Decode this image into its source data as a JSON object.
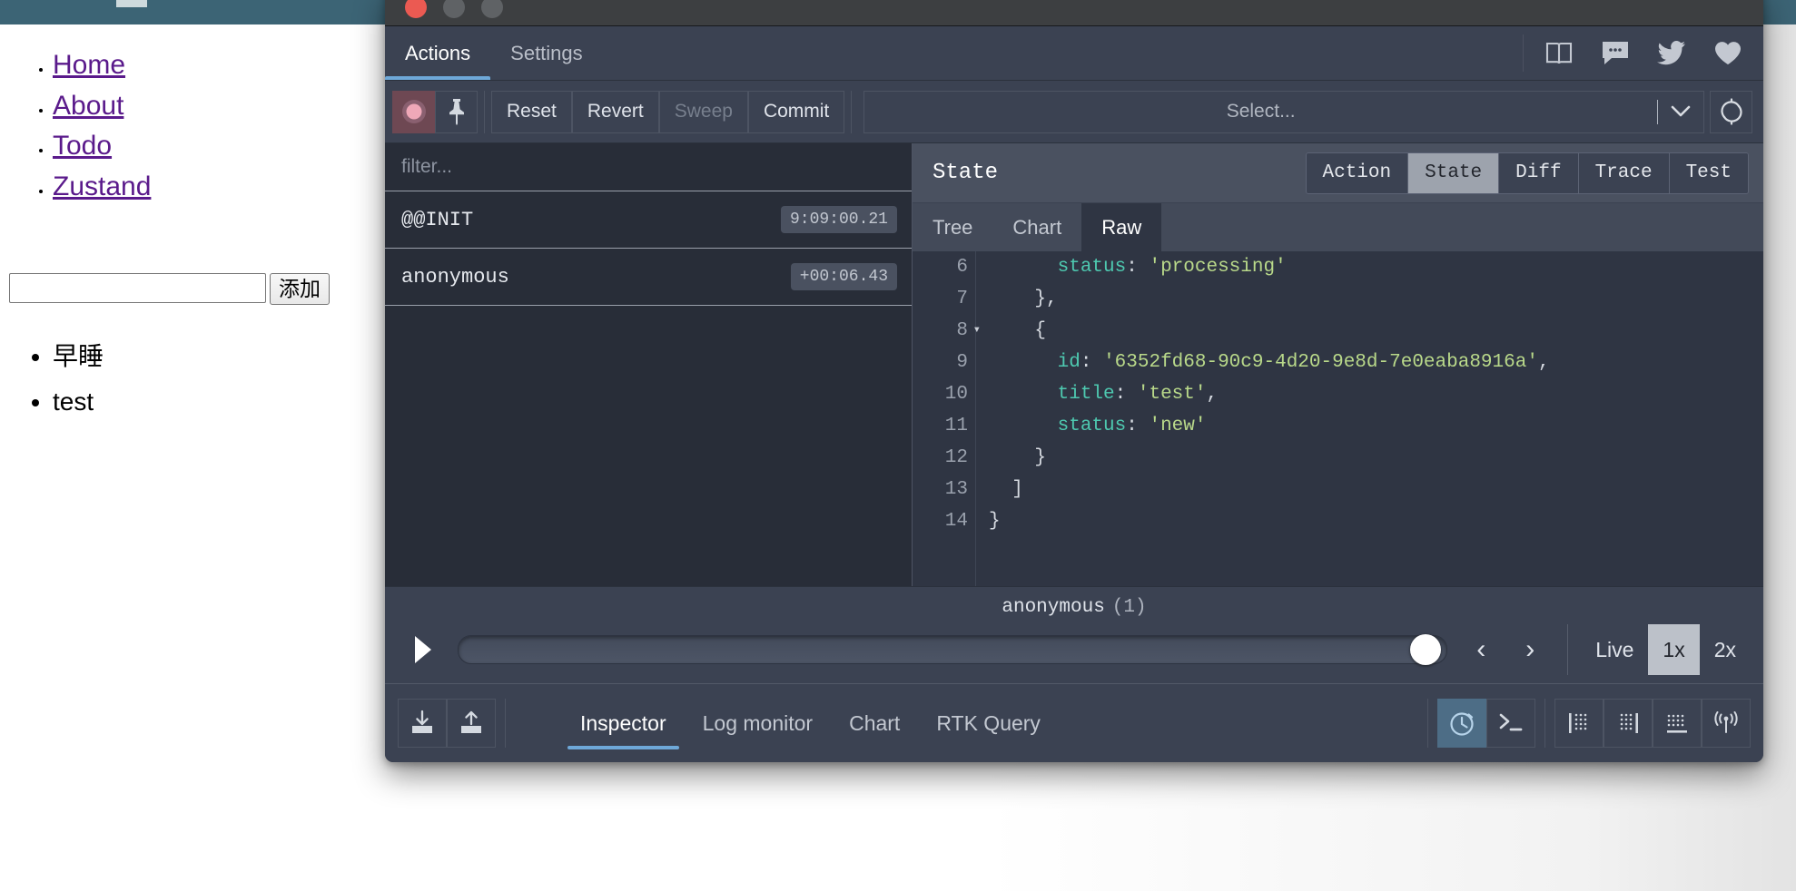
{
  "page": {
    "nav": [
      {
        "label": "Home"
      },
      {
        "label": "About"
      },
      {
        "label": "Todo"
      },
      {
        "label": "Zustand"
      }
    ],
    "todo_input_value": "",
    "todo_input_placeholder": "",
    "add_button_label": "添加",
    "todos": [
      {
        "label": "早睡"
      },
      {
        "label": "test"
      }
    ],
    "topbar_color": "#3c6475"
  },
  "devtools": {
    "window_controls": {
      "close_color": "#eb5a52",
      "minimize_color": "#5f6265",
      "zoom_color": "#5f6265"
    },
    "top_tabs": [
      {
        "label": "Actions",
        "active": true
      },
      {
        "label": "Settings",
        "active": false
      }
    ],
    "social_icons": [
      {
        "name": "book-icon"
      },
      {
        "name": "chat-icon"
      },
      {
        "name": "twitter-icon"
      },
      {
        "name": "heart-icon"
      }
    ],
    "toolbar": {
      "record_label": "",
      "pin_label": "",
      "reset_label": "Reset",
      "revert_label": "Revert",
      "sweep_label": "Sweep",
      "commit_label": "Commit",
      "select_placeholder": "Select...",
      "refresh_label": ""
    },
    "actions_panel": {
      "filter_placeholder": "filter...",
      "rows": [
        {
          "name": "@@INIT",
          "time": "9:09:00.21"
        },
        {
          "name": "anonymous",
          "time": "+00:06.43"
        }
      ]
    },
    "inspector": {
      "title": "State",
      "segments": [
        {
          "label": "Action",
          "active": false
        },
        {
          "label": "State",
          "active": true
        },
        {
          "label": "Diff",
          "active": false
        },
        {
          "label": "Trace",
          "active": false
        },
        {
          "label": "Test",
          "active": false
        }
      ],
      "subtabs": [
        {
          "label": "Tree",
          "active": false
        },
        {
          "label": "Chart",
          "active": false
        },
        {
          "label": "Raw",
          "active": true
        }
      ],
      "code_lines": [
        {
          "num": "6",
          "fold": "",
          "segments": [
            {
              "t": "      ",
              "c": "punc"
            },
            {
              "t": "status",
              "c": "key"
            },
            {
              "t": ": ",
              "c": "punc"
            },
            {
              "t": "'processing'",
              "c": "str"
            }
          ]
        },
        {
          "num": "7",
          "fold": "",
          "segments": [
            {
              "t": "    },",
              "c": "punc"
            }
          ]
        },
        {
          "num": "8",
          "fold": "▾",
          "segments": [
            {
              "t": "    {",
              "c": "punc"
            }
          ]
        },
        {
          "num": "9",
          "fold": "",
          "segments": [
            {
              "t": "      ",
              "c": "punc"
            },
            {
              "t": "id",
              "c": "key"
            },
            {
              "t": ": ",
              "c": "punc"
            },
            {
              "t": "'6352fd68-90c9-4d20-9e8d-7e0eaba8916a'",
              "c": "str"
            },
            {
              "t": ",",
              "c": "punc"
            }
          ]
        },
        {
          "num": "10",
          "fold": "",
          "segments": [
            {
              "t": "      ",
              "c": "punc"
            },
            {
              "t": "title",
              "c": "key"
            },
            {
              "t": ": ",
              "c": "punc"
            },
            {
              "t": "'test'",
              "c": "str"
            },
            {
              "t": ",",
              "c": "punc"
            }
          ]
        },
        {
          "num": "11",
          "fold": "",
          "segments": [
            {
              "t": "      ",
              "c": "punc"
            },
            {
              "t": "status",
              "c": "key"
            },
            {
              "t": ": ",
              "c": "punc"
            },
            {
              "t": "'new'",
              "c": "str"
            }
          ]
        },
        {
          "num": "12",
          "fold": "",
          "segments": [
            {
              "t": "    }",
              "c": "punc"
            }
          ]
        },
        {
          "num": "13",
          "fold": "",
          "segments": [
            {
              "t": "  ]",
              "c": "punc"
            }
          ]
        },
        {
          "num": "14",
          "fold": "",
          "segments": [
            {
              "t": "}",
              "c": "punc"
            }
          ]
        }
      ]
    },
    "slider": {
      "action_label": "anonymous",
      "action_count": "(1)",
      "position_percent": 100,
      "prev_label": "‹",
      "next_label": "›",
      "live_label": "Live",
      "speed_1x_label": "1x",
      "speed_2x_label": "2x",
      "speed_active": "1x"
    },
    "bottom": {
      "import_label": "",
      "export_label": "",
      "tabs": [
        {
          "label": "Inspector",
          "active": true
        },
        {
          "label": "Log monitor",
          "active": false
        },
        {
          "label": "Chart",
          "active": false
        },
        {
          "label": "RTK Query",
          "active": false
        }
      ],
      "icons": [
        {
          "name": "timer-icon",
          "active": true
        },
        {
          "name": "terminal-icon",
          "active": false
        },
        {
          "name": "dock-left-icon",
          "active": false
        },
        {
          "name": "dock-right-icon",
          "active": false
        },
        {
          "name": "dock-bottom-icon",
          "active": false
        },
        {
          "name": "broadcast-icon",
          "active": false
        }
      ]
    }
  },
  "colors": {
    "accent_blue": "#6ea8d8",
    "panel_bg": "#3b4252",
    "list_bg": "#282d38",
    "code_bg": "#2f3543",
    "header_bg": "#4a5160",
    "key_color": "#4ec9b0",
    "string_color": "#b9d98a"
  }
}
